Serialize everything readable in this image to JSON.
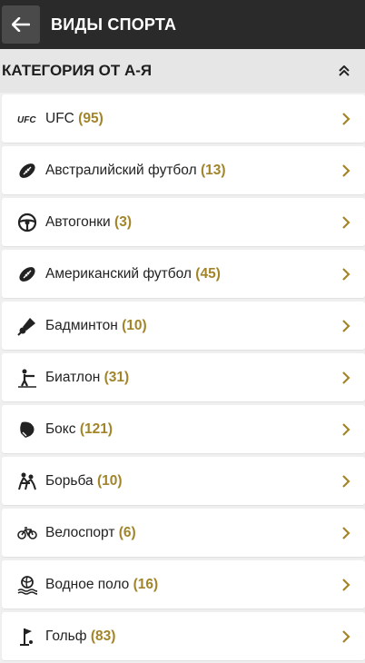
{
  "header": {
    "title": "ВИДЫ СПОРТА"
  },
  "category": {
    "title": "КАТЕГОРИЯ ОТ А-Я"
  },
  "colors": {
    "accent": "#a2852a",
    "header_bg": "#2a2a2a"
  },
  "sports": [
    {
      "name": "UFC",
      "count": "(95)",
      "icon": "ufc-icon"
    },
    {
      "name": "Австралийский футбол",
      "count": "(13)",
      "icon": "football-icon"
    },
    {
      "name": "Автогонки",
      "count": "(3)",
      "icon": "steering-wheel-icon"
    },
    {
      "name": "Американский футбол",
      "count": "(45)",
      "icon": "football-icon"
    },
    {
      "name": "Бадминтон",
      "count": "(10)",
      "icon": "shuttlecock-icon"
    },
    {
      "name": "Биатлон",
      "count": "(31)",
      "icon": "biathlon-icon"
    },
    {
      "name": "Бокс",
      "count": "(121)",
      "icon": "boxing-glove-icon"
    },
    {
      "name": "Борьба",
      "count": "(10)",
      "icon": "wrestling-icon"
    },
    {
      "name": "Велоспорт",
      "count": "(6)",
      "icon": "bicycle-icon"
    },
    {
      "name": "Водное поло",
      "count": "(16)",
      "icon": "water-polo-icon"
    },
    {
      "name": "Гольф",
      "count": "(83)",
      "icon": "golf-icon"
    }
  ]
}
